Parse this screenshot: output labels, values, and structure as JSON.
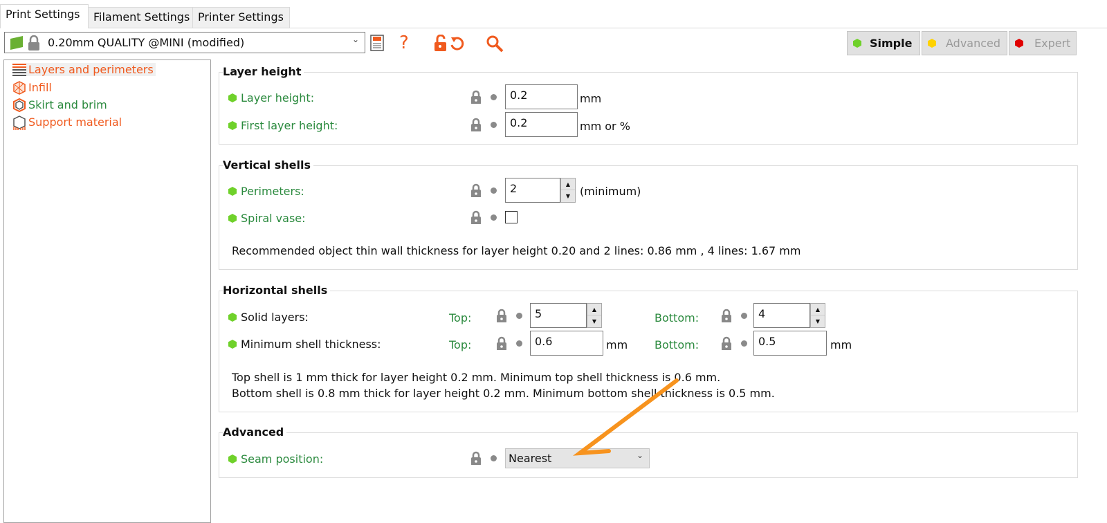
{
  "tabs": [
    {
      "label": "Print Settings",
      "active": true
    },
    {
      "label": "Filament Settings"
    },
    {
      "label": "Printer Settings"
    }
  ],
  "preset": {
    "value": "0.20mm QUALITY @MINI (modified)",
    "icons": [
      "flag-icon",
      "lock-icon"
    ]
  },
  "toolbar": {
    "icons": [
      "save-icon",
      "question-icon",
      "unlock-icon",
      "undo-icon",
      "search-icon"
    ],
    "help": "?"
  },
  "modes": [
    {
      "label": "Simple",
      "color": "#6fd12a",
      "active": true
    },
    {
      "label": "Advanced",
      "color": "#ffd200"
    },
    {
      "label": "Expert",
      "color": "#e00000"
    }
  ],
  "tree": [
    {
      "label": "Layers and perimeters",
      "color": "#f05a1e",
      "selected": true
    },
    {
      "label": "Infill",
      "color": "#f05a1e"
    },
    {
      "label": "Skirt and brim",
      "color": "#2b8a3e"
    },
    {
      "label": "Support material",
      "color": "#f05a1e"
    }
  ],
  "groups": {
    "layer_height": {
      "title": "Layer height",
      "layer_height": {
        "label": "Layer height:",
        "value": "0.2",
        "unit": "mm"
      },
      "first_layer_height": {
        "label": "First layer height:",
        "value": "0.2",
        "unit": "mm or %"
      }
    },
    "vertical_shells": {
      "title": "Vertical shells",
      "perimeters": {
        "label": "Perimeters:",
        "value": "2",
        "unit": "(minimum)"
      },
      "spiral_vase": {
        "label": "Spiral vase:",
        "checked": false
      },
      "note": "Recommended object thin wall thickness for layer height 0.20 and 2 lines: 0.86 mm , 4 lines: 1.67 mm"
    },
    "horizontal_shells": {
      "title": "Horizontal shells",
      "top_label": "Top:",
      "bottom_label": "Bottom:",
      "solid_layers": {
        "label": "Solid layers:",
        "top": "5",
        "bottom": "4"
      },
      "min_shell": {
        "label": "Minimum shell thickness:",
        "top": "0.6",
        "bottom": "0.5",
        "unit": "mm"
      },
      "note1": "Top shell is 1 mm thick for layer height 0.2 mm. Minimum top shell thickness is 0.6 mm.",
      "note2": "Bottom shell is 0.8 mm thick for layer height 0.2 mm. Minimum bottom shell thickness is 0.5 mm."
    },
    "advanced": {
      "title": "Advanced",
      "seam_position": {
        "label": "Seam position:",
        "value": "Nearest"
      }
    }
  },
  "annotation": {
    "arrow_color": "#f7931e"
  }
}
